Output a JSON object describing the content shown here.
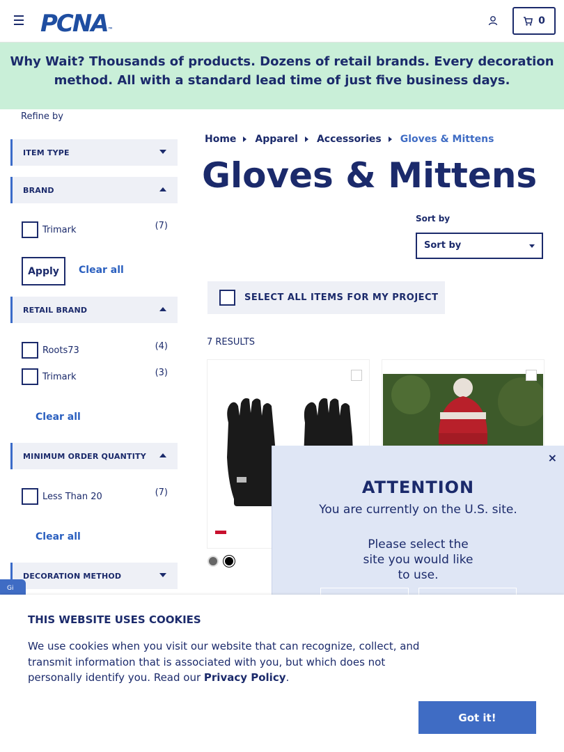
{
  "header": {
    "logo_text": "PCNA",
    "logo_tm": "™",
    "cart_count": "0"
  },
  "banner": {
    "lead": "Why Wait?",
    "text": " Thousands of products. Dozens of retail brands. Every decoration method. All with a standard lead time of just five business days."
  },
  "sidebar": {
    "refine_label": "Refine by",
    "facets": {
      "item_type": "ITEM TYPE",
      "brand": "BRAND",
      "retail_brand": "RETAIL BRAND",
      "moq": "MINIMUM ORDER QUANTITY",
      "decoration": "DECORATION METHOD"
    },
    "brand_options": [
      {
        "label": "Trimark",
        "count": "(7)"
      }
    ],
    "retail_brand_options": [
      {
        "label": "Roots73",
        "count": "(4)"
      },
      {
        "label": "Trimark",
        "count": "(3)"
      }
    ],
    "moq_options": [
      {
        "label": "Less Than 20",
        "count": "(7)"
      }
    ],
    "apply_label": "Apply",
    "clear_all_label": "Clear all"
  },
  "breadcrumb": [
    "Home",
    "Apparel",
    "Accessories",
    "Gloves & Mittens"
  ],
  "page_title": "Gloves & Mittens",
  "sort": {
    "label": "Sort by",
    "selected": "Sort by"
  },
  "select_all_label": "SELECT ALL ITEMS FOR MY PROJECT",
  "results_label": "7 RESULTS",
  "colors": {
    "brand": "#1b2a6b",
    "accent": "#3f6cc4",
    "banner_bg": "#c9efd8",
    "modal_bg": "#dfe6f5"
  },
  "modal": {
    "close": "×",
    "title": "ATTENTION",
    "line1": "You are currently on the U.S. site.",
    "line2": "Please select the site you would like to use."
  },
  "cookie": {
    "title": "THIS WEBSITE USES COOKIES",
    "text": "We use cookies when you visit our website that can recognize, collect, and transmit information that is associated with you, but which does not personally identify you. Read our ",
    "link": "Privacy Policy",
    "period": ".",
    "button": "Got it!"
  },
  "gift_tab": "Gi"
}
